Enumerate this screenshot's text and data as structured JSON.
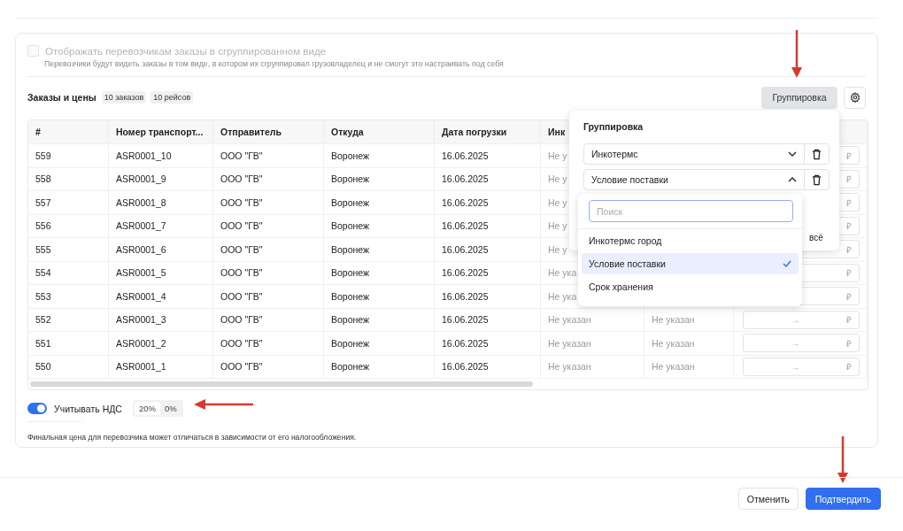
{
  "grouped_view": {
    "label": "Отображать перевозчикам заказы в сгруппированном виде",
    "checked": false,
    "disabled": true,
    "hint": "Перевозчики будут видеть заказы в том виде, в котором их сгруппировал грузовладелец и не смогут это настраивать под себя"
  },
  "orders": {
    "title": "Заказы и цены",
    "badges": [
      "10 заказов",
      "10 рейсов"
    ],
    "grouping_button": "Группировка"
  },
  "table": {
    "columns": [
      "#",
      "Номер транспорт...",
      "Отправитель",
      "Откуда",
      "Дата погрузки",
      "Инк"
    ],
    "rows": [
      {
        "num": "559",
        "transport": "ASR0001_10",
        "sender": "ООО \"ГВ\"",
        "from": "Воронеж",
        "date": "16.06.2025",
        "column_6": "Не у",
        "currency": "₽"
      },
      {
        "num": "558",
        "transport": "ASR0001_9",
        "sender": "ООО \"ГВ\"",
        "from": "Воронеж",
        "date": "16.06.2025",
        "column_6": "Не у",
        "currency": "₽"
      },
      {
        "num": "557",
        "transport": "ASR0001_8",
        "sender": "ООО \"ГВ\"",
        "from": "Воронеж",
        "date": "16.06.2025",
        "column_6": "Не у",
        "currency": "₽"
      },
      {
        "num": "556",
        "transport": "ASR0001_7",
        "sender": "ООО \"ГВ\"",
        "from": "Воронеж",
        "date": "16.06.2025",
        "column_6": "Не у",
        "currency": "₽"
      },
      {
        "num": "555",
        "transport": "ASR0001_6",
        "sender": "ООО \"ГВ\"",
        "from": "Воронеж",
        "date": "16.06.2025",
        "column_6": "Не у",
        "currency": "₽"
      },
      {
        "num": "554",
        "transport": "ASR0001_5",
        "sender": "ООО \"ГВ\"",
        "from": "Воронеж",
        "date": "16.06.2025",
        "column_6": "Не ука",
        "currency": "₽"
      },
      {
        "num": "553",
        "transport": "ASR0001_4",
        "sender": "ООО \"ГВ\"",
        "from": "Воронеж",
        "date": "16.06.2025",
        "column_6": "Не ука",
        "currency": "₽"
      },
      {
        "num": "552",
        "transport": "ASR0001_3",
        "sender": "ООО \"ГВ\"",
        "from": "Воронеж",
        "date": "16.06.2025",
        "column_6": "Не указан",
        "column_7": "Не указан",
        "arrow": "→",
        "currency": "₽"
      },
      {
        "num": "551",
        "transport": "ASR0001_2",
        "sender": "ООО \"ГВ\"",
        "from": "Воронеж",
        "date": "16.06.2025",
        "column_6": "Не указан",
        "column_7": "Не указан",
        "arrow": "→",
        "currency": "₽"
      },
      {
        "num": "550",
        "transport": "ASR0001_1",
        "sender": "ООО \"ГВ\"",
        "from": "Воронеж",
        "date": "16.06.2025",
        "column_6": "Не указан",
        "column_7": "Не указан",
        "arrow": "→",
        "currency": "₽"
      }
    ]
  },
  "grouping_popover": {
    "title": "Группировка",
    "selects": [
      {
        "value": "Инкотермс",
        "expanded": false
      },
      {
        "value": "Условие поставки",
        "expanded": true
      }
    ],
    "partial_link": "всё",
    "dropdown": {
      "search": {
        "placeholder": "Поиск"
      },
      "options": [
        {
          "label": "Инкотермс город",
          "selected": false
        },
        {
          "label": "Условие поставки",
          "selected": true
        },
        {
          "label": "Срок хранения",
          "selected": false
        }
      ]
    }
  },
  "vat": {
    "label": "Учитывать НДС",
    "on": true,
    "options": [
      {
        "label": "20%",
        "selected": true
      },
      {
        "label": "0%",
        "selected": false
      }
    ],
    "note": "Финальная цена для перевозчика может отличаться в зависимости от его налогообложения."
  },
  "footer": {
    "buttons": [
      {
        "label": "Отменить",
        "kind": "secondary"
      },
      {
        "label": "Подтвердить",
        "kind": "primary"
      }
    ]
  }
}
